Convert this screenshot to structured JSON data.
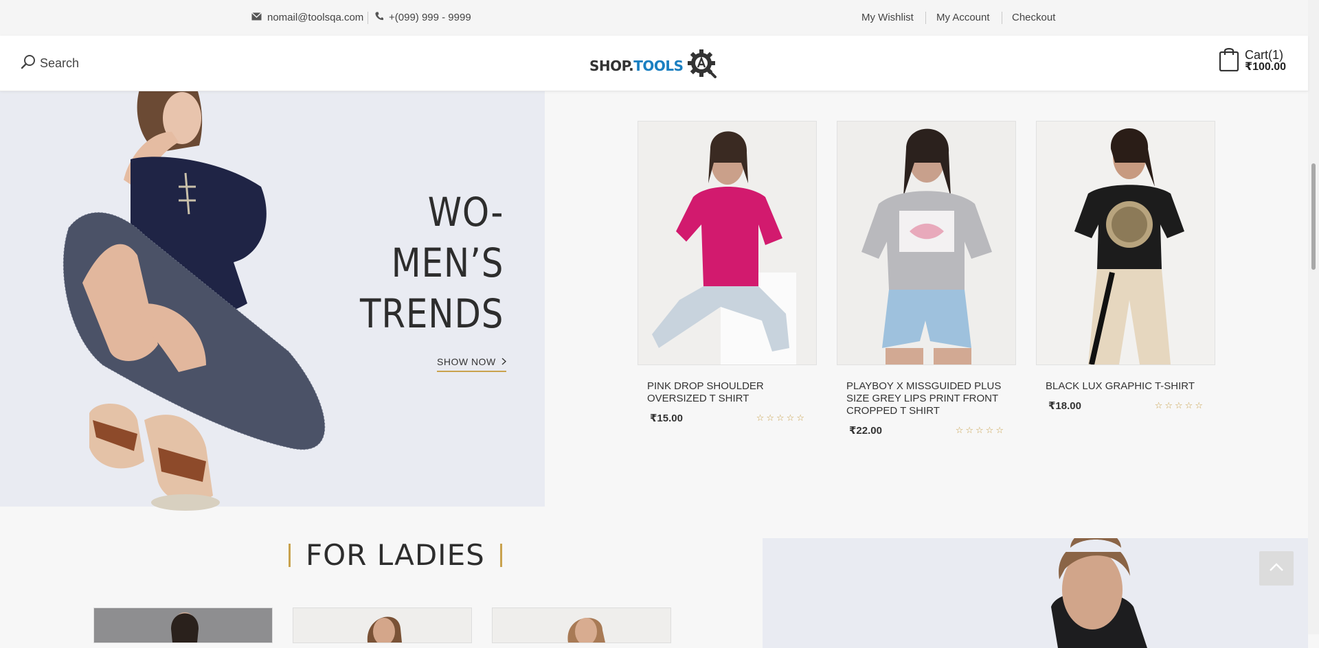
{
  "topbar": {
    "email": "nomail@toolsqa.com",
    "phone": "+(099) 999 - 9999",
    "wishlist": "My Wishlist",
    "account": "My Account",
    "checkout": "Checkout"
  },
  "header": {
    "search_label": "Search",
    "logo_shop": "SHOP.",
    "logo_tools": "TOOLS",
    "cart_label": "Cart(1)",
    "cart_total": "₹100.00"
  },
  "hero": {
    "title_line1": "WO-",
    "title_line2": "MEN’S",
    "title_line3": "TRENDS",
    "cta": "SHOW NOW"
  },
  "products": [
    {
      "name": "PINK DROP SHOULDER OVERSIZED T SHIRT",
      "price": "₹15.00",
      "rating": 0,
      "shirt_color": "#d21a6e"
    },
    {
      "name": "PLAYBOY X MISSGUIDED PLUS SIZE GREY LIPS PRINT FRONT CROPPED T SHIRT",
      "price": "₹22.00",
      "rating": 0,
      "shirt_color": "#b9b9bd"
    },
    {
      "name": "BLACK LUX GRAPHIC T-SHIRT",
      "price": "₹18.00",
      "rating": 0,
      "shirt_color": "#1c1c1c"
    }
  ],
  "section": {
    "for_ladies": "FOR LADIES"
  },
  "colors": {
    "accent": "#c9a24e",
    "logo_blue": "#1a7fc1",
    "logo_dark": "#333333"
  }
}
